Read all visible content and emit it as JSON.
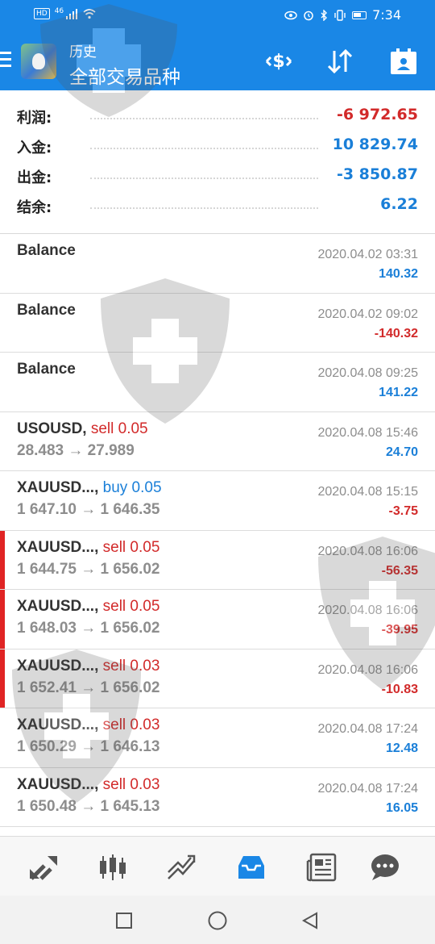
{
  "status_bar": {
    "hd": "HD",
    "network": "46",
    "time": "7:34"
  },
  "header": {
    "subtitle": "历史",
    "title": "全部交易品种"
  },
  "summary": [
    {
      "label": "利润:",
      "value": "-6 972.65"
    },
    {
      "label": "入金:",
      "value": "10 829.74"
    },
    {
      "label": "出金:",
      "value": "-3 850.87"
    },
    {
      "label": "结余:",
      "value": "6.22"
    }
  ],
  "deals": [
    {
      "symbol": "Balance",
      "side": "",
      "prices": "",
      "time": "2020.04.02 03:31",
      "profit": "140.32"
    },
    {
      "symbol": "Balance",
      "side": "",
      "prices": "",
      "time": "2020.04.02 09:02",
      "profit": "-140.32"
    },
    {
      "symbol": "Balance",
      "side": "",
      "prices": "",
      "time": "2020.04.08 09:25",
      "profit": "141.22"
    },
    {
      "symbol": "USOUSD, ",
      "side": "sell 0.05",
      "prices": "28.483 → 27.989",
      "time": "2020.04.08 15:46",
      "profit": "24.70"
    },
    {
      "symbol": "XAUUSD..., ",
      "side": "buy 0.05",
      "prices": "1 647.10 → 1 646.35",
      "time": "2020.04.08 15:15",
      "profit": "-3.75"
    },
    {
      "symbol": "XAUUSD..., ",
      "side": "sell 0.05",
      "prices": "1 644.75 → 1 656.02",
      "time": "2020.04.08 16:06",
      "profit": "-56.35"
    },
    {
      "symbol": "XAUUSD..., ",
      "side": "sell 0.05",
      "prices": "1 648.03 → 1 656.02",
      "time": "2020.04.08 16:06",
      "profit": "-39.95"
    },
    {
      "symbol": "XAUUSD..., ",
      "side": "sell 0.03",
      "prices": "1 652.41 → 1 656.02",
      "time": "2020.04.08 16:06",
      "profit": "-10.83"
    },
    {
      "symbol": "XAUUSD..., ",
      "side": "sell 0.03",
      "prices": "1 650.29 → 1 646.13",
      "time": "2020.04.08 17:24",
      "profit": "12.48"
    },
    {
      "symbol": "XAUUSD..., ",
      "side": "sell 0.03",
      "prices": "1 650.48 → 1 645.13",
      "time": "2020.04.08 17:24",
      "profit": "16.05"
    }
  ],
  "tabs": [
    {
      "icon": "quotes-icon"
    },
    {
      "icon": "chart-icon"
    },
    {
      "icon": "trade-icon"
    },
    {
      "icon": "history-icon",
      "active": true
    },
    {
      "icon": "news-icon"
    },
    {
      "icon": "chat-icon"
    }
  ],
  "colors": {
    "accent": "#1a87e6",
    "positive": "#1a7fd8",
    "negative": "#d22a2a",
    "marker": "#e02424"
  }
}
